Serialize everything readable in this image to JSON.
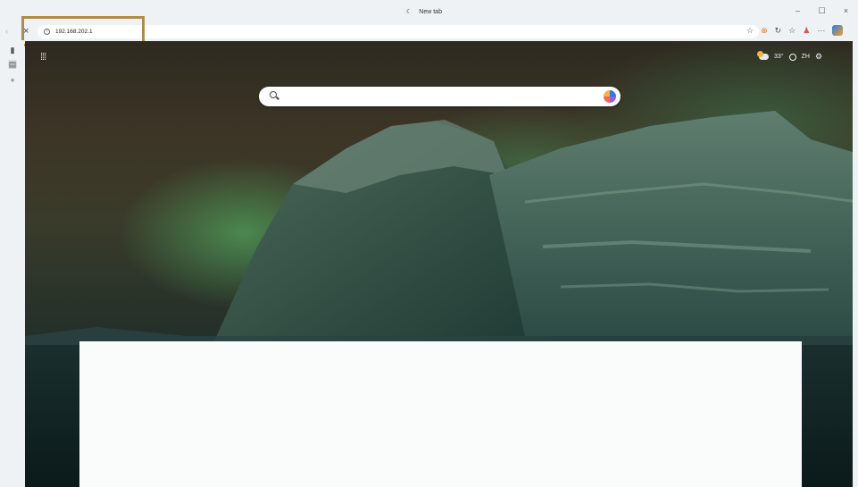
{
  "window": {
    "tab_title": "New tab",
    "controls": {
      "minimize": "–",
      "maximize": "☐",
      "close": "×"
    }
  },
  "navbar": {
    "url": "192.168.202.1"
  },
  "toolbar": {
    "icons": [
      "star-icon",
      "extension-icon",
      "refresh-icon",
      "favorites-icon",
      "profile-icon",
      "more-icon",
      "copilot-icon"
    ],
    "more_label": "···"
  },
  "newtab": {
    "weather_temp": "33°",
    "language": "ZH"
  },
  "colors": {
    "highlight": "#b08a47",
    "aurora_green": "#5ac86e"
  }
}
